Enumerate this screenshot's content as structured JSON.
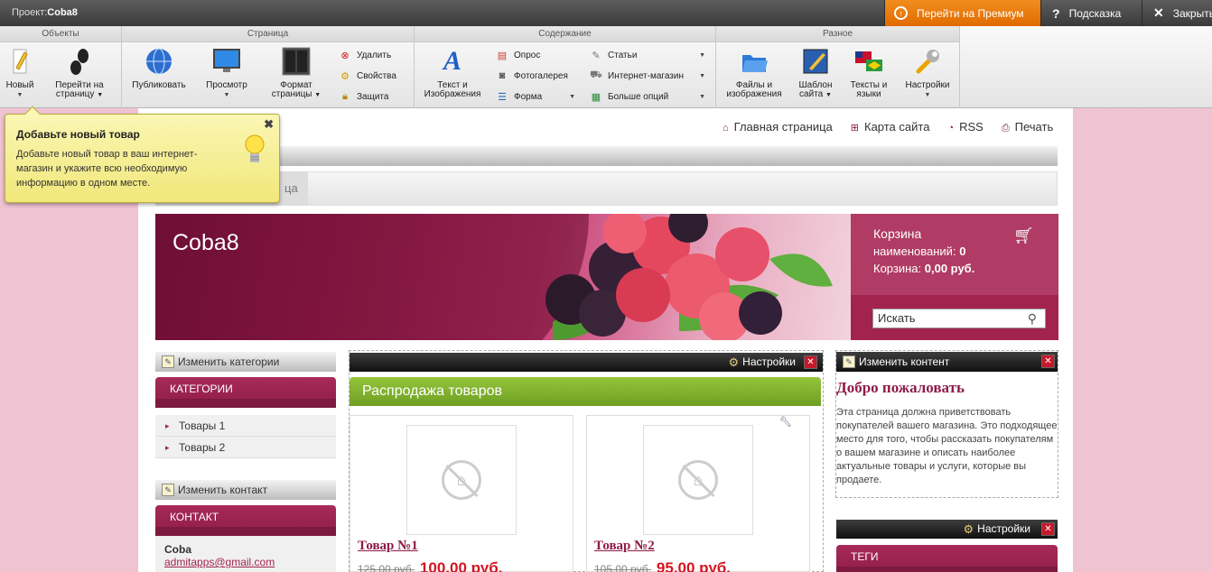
{
  "topbar": {
    "project_label": "Проект:",
    "project_name": "Coba8",
    "premium": "Перейти на Премиум",
    "help": "Подсказка",
    "close": "Закрыть"
  },
  "ribbon": {
    "groups": {
      "objects": "Объекты",
      "page": "Страница",
      "content": "Содержание",
      "misc": "Разное"
    },
    "new": "Новый",
    "goto_page": "Перейти на\nстраницу",
    "publish": "Публиковать",
    "preview": "Просмотр",
    "page_format": "Формат\nстраницы",
    "delete": "Удалить",
    "properties": "Свойства",
    "protection": "Защита",
    "text_images": "Текст и\nИзображения",
    "poll": "Опрос",
    "gallery": "Фотогалерея",
    "form": "Форма",
    "articles": "Статьи",
    "eshop": "Интернет-магазин",
    "more": "Больше опций",
    "files_images": "Файлы и\nизображения",
    "site_template": "Шаблон\nсайта",
    "texts_languages": "Тексты и\nязыки",
    "settings": "Настройки"
  },
  "tooltip": {
    "title": "Добавьте новый товар",
    "body": "Добавьте новый товар в ваш интернет-магазин и укажите всю необходимую информацию в одном месте."
  },
  "toplinks": {
    "home": "Главная страница",
    "sitemap": "Карта сайта",
    "rss": "RSS",
    "print": "Печать"
  },
  "nav": {
    "partial_tab": "ца"
  },
  "banner": {
    "title": "Coba8"
  },
  "cart": {
    "title": "Корзина",
    "items_label": "наименований:",
    "items_value": "0",
    "total_label": "Корзина:",
    "total_value": "0,00 руб.",
    "search_placeholder": "Искать"
  },
  "left": {
    "edit_categories": "Изменить категории",
    "categories_title": "КАТЕГОРИИ",
    "categories": [
      "Товары 1",
      "Товары 2"
    ],
    "edit_contact": "Изменить контакт",
    "contact_title": "КОНТАКТ",
    "contact_name": "Coba",
    "contact_email": "admitapps@gmail.com"
  },
  "center": {
    "settings": "Настройки",
    "sale_title": "Распродажа товаров",
    "products": [
      {
        "title": "Товар №1",
        "old_price": "125,00 руб.",
        "price": "100,00 руб."
      },
      {
        "title": "Товар №2",
        "old_price": "105,00 руб.",
        "price": "95,00 руб."
      }
    ]
  },
  "right": {
    "edit_content": "Изменить контент",
    "welcome_title": "Добро пожаловать",
    "welcome_text": "Эта страница должна приветствовать покупателей вашего магазина. Это подходящее место для того, чтобы рассказать покупателям о вашем магазине и описать наиболее актуальные товары и услуги, которые вы продаете.",
    "settings": "Настройки",
    "tags_title": "ТЕГИ"
  },
  "colors": {
    "accent": "#a3234f",
    "premium": "#e97a0f",
    "sale_green": "#84b52f",
    "background": "#f0c3d3"
  }
}
